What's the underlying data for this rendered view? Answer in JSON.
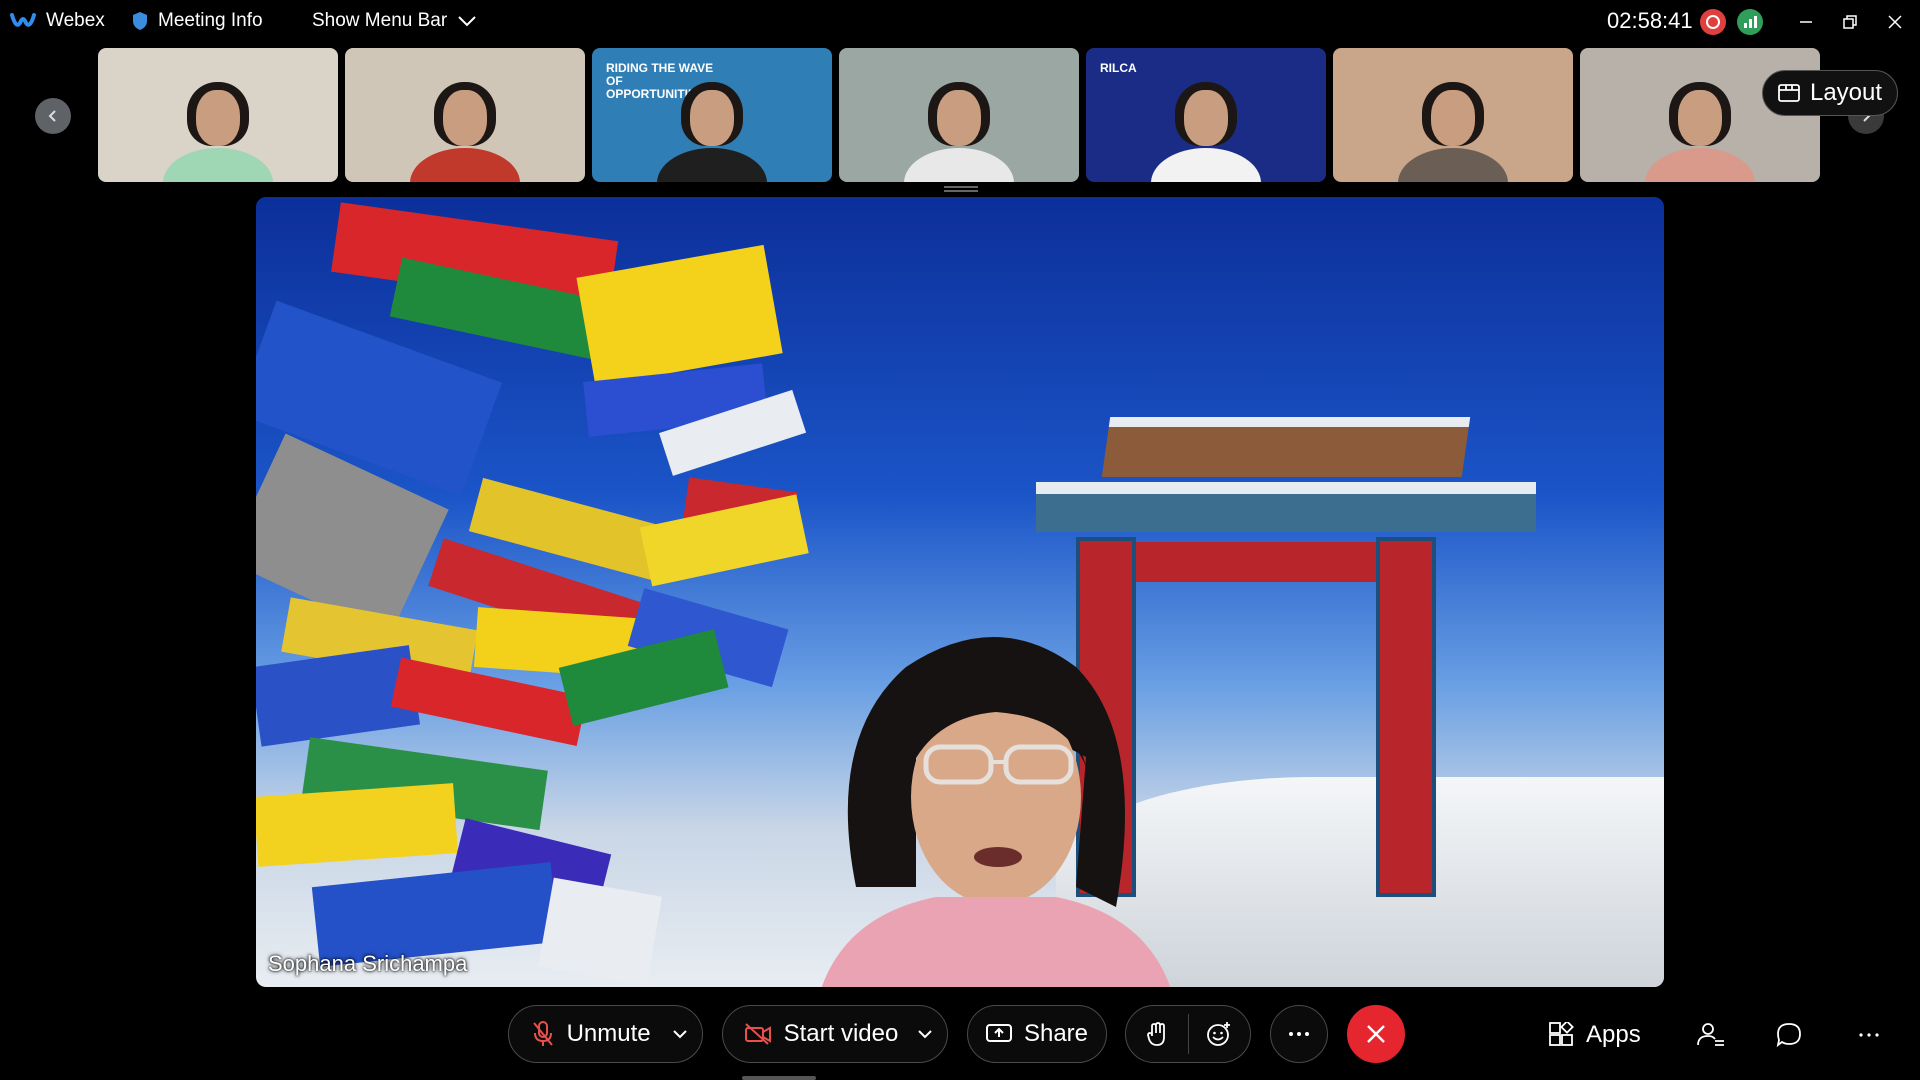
{
  "topbar": {
    "app_name": "Webex",
    "meeting_info": "Meeting Info",
    "show_menu_bar": "Show Menu Bar",
    "timer": "02:58:41"
  },
  "filmstrip": {
    "layout_label": "Layout",
    "thumbnails": [
      {
        "id": "participant-1",
        "bg": "#d9d3c8",
        "shirt": "#9fd6b3"
      },
      {
        "id": "participant-2",
        "bg": "#cfc6b8",
        "shirt": "#c0392b"
      },
      {
        "id": "participant-3",
        "bg": "#2f7fb6",
        "shirt": "#1f1f1f",
        "overlay_text": "RIDING THE WAVE OF OPPORTUNITIES"
      },
      {
        "id": "participant-4",
        "bg": "#9aa7a3",
        "shirt": "#e8e8e8"
      },
      {
        "id": "participant-5",
        "bg": "#1b2c86",
        "shirt": "#f2f2f2",
        "overlay_text": "RILCA"
      },
      {
        "id": "participant-6",
        "bg": "#c9a58a",
        "shirt": "#6b5e55"
      },
      {
        "id": "participant-7",
        "bg": "#b7b1a9",
        "shirt": "#d99a8c"
      }
    ]
  },
  "stage": {
    "speaker_name": "Sophana Srichampa"
  },
  "controls": {
    "unmute": "Unmute",
    "start_video": "Start video",
    "share": "Share",
    "apps": "Apps"
  },
  "colors": {
    "leave_red": "#e5262f",
    "recording_red": "#e0403d",
    "network_green": "#2f9e5b",
    "muted_icon_red": "#e8514b"
  }
}
